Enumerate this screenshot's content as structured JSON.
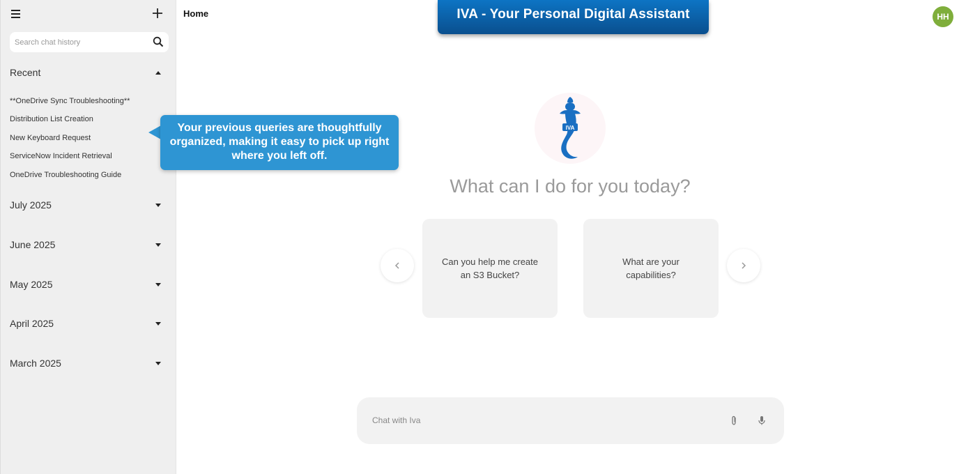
{
  "sidebar": {
    "menu_icon": "hamburger-menu-icon",
    "new_chat_icon": "plus-icon",
    "search": {
      "placeholder": "Search chat history",
      "icon": "search-icon"
    },
    "recent": {
      "label": "Recent",
      "expanded": true,
      "items": [
        "**OneDrive Sync Troubleshooting**",
        "Distribution List Creation",
        "New Keyboard Request",
        "ServiceNow Incident Retrieval",
        "OneDrive Troubleshooting Guide"
      ]
    },
    "sections": [
      {
        "label": "July 2025",
        "expanded": false
      },
      {
        "label": "June 2025",
        "expanded": false
      },
      {
        "label": "May 2025",
        "expanded": false
      },
      {
        "label": "April 2025",
        "expanded": false
      },
      {
        "label": "March 2025",
        "expanded": false
      }
    ]
  },
  "header": {
    "breadcrumb": "Home",
    "banner_title": "IVA - Your Personal Digital Assistant",
    "avatar_initials": "HH",
    "avatar_color": "#7fae3b"
  },
  "main": {
    "logo_text": "IVA",
    "greeting": "What can I do for you today?",
    "suggestions": [
      "Can you help me create an S3 Bucket?",
      "What are your capabilities?"
    ],
    "prev_icon": "chevron-left-icon",
    "next_icon": "chevron-right-icon"
  },
  "chat": {
    "placeholder": "Chat with Iva",
    "attach_icon": "paperclip-icon",
    "mic_icon": "microphone-icon"
  },
  "callout": {
    "text": "Your previous queries are thoughtfully organized, making it easy to pick up right where you left off.",
    "color": "#2e95d3"
  },
  "colors": {
    "banner": "#0a4f8e",
    "accent_blue": "#1a6fc2"
  }
}
